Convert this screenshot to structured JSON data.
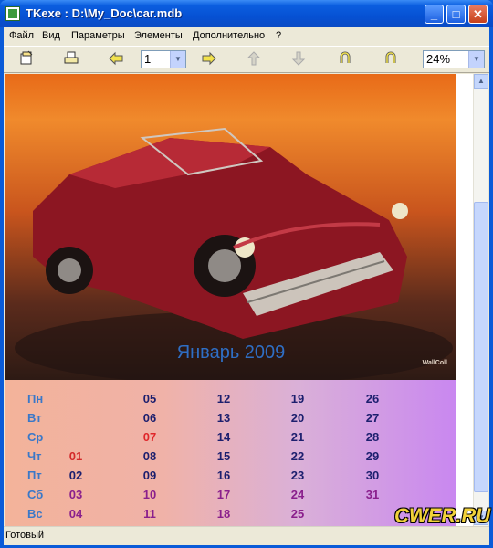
{
  "window": {
    "title": "TKexe : D:\\My_Doc\\car.mdb"
  },
  "title_buttons": {
    "minimize": "_",
    "maximize": "□",
    "close": "✕"
  },
  "menu": [
    "Файл",
    "Вид",
    "Параметры",
    "Элементы",
    "Дополнительно",
    "?"
  ],
  "toolbar": {
    "icons": [
      "open-icon",
      "print-icon",
      "back-arrow-icon",
      "forward-arrow-icon",
      "up-arrow-icon",
      "down-arrow-icon",
      "rotate-left-icon",
      "rotate-right-icon"
    ],
    "page_value": "1",
    "zoom_value": "24%"
  },
  "calendar": {
    "title": "Январь 2009",
    "watermark": "WallColl",
    "days": [
      "Пн",
      "Вт",
      "Ср",
      "Чт",
      "Пт",
      "Сб",
      "Вс"
    ],
    "weeks": [
      [
        "",
        "",
        "",
        "01",
        "02",
        "03",
        "04"
      ],
      [
        "05",
        "06",
        "07",
        "08",
        "09",
        "10",
        "11"
      ],
      [
        "12",
        "13",
        "14",
        "15",
        "16",
        "17",
        "18"
      ],
      [
        "19",
        "20",
        "21",
        "22",
        "23",
        "24",
        "25"
      ],
      [
        "26",
        "27",
        "28",
        "29",
        "30",
        "31",
        ""
      ]
    ],
    "colors": {
      "weekday": "#1c1f6e",
      "weekend": "#8a1f8c",
      "highlight": "#e0262a",
      "dayname": "#3a78c8",
      "start": "#d42a2a"
    }
  },
  "status": {
    "text": "Готовый"
  },
  "corner_logo": "CWER.RU"
}
